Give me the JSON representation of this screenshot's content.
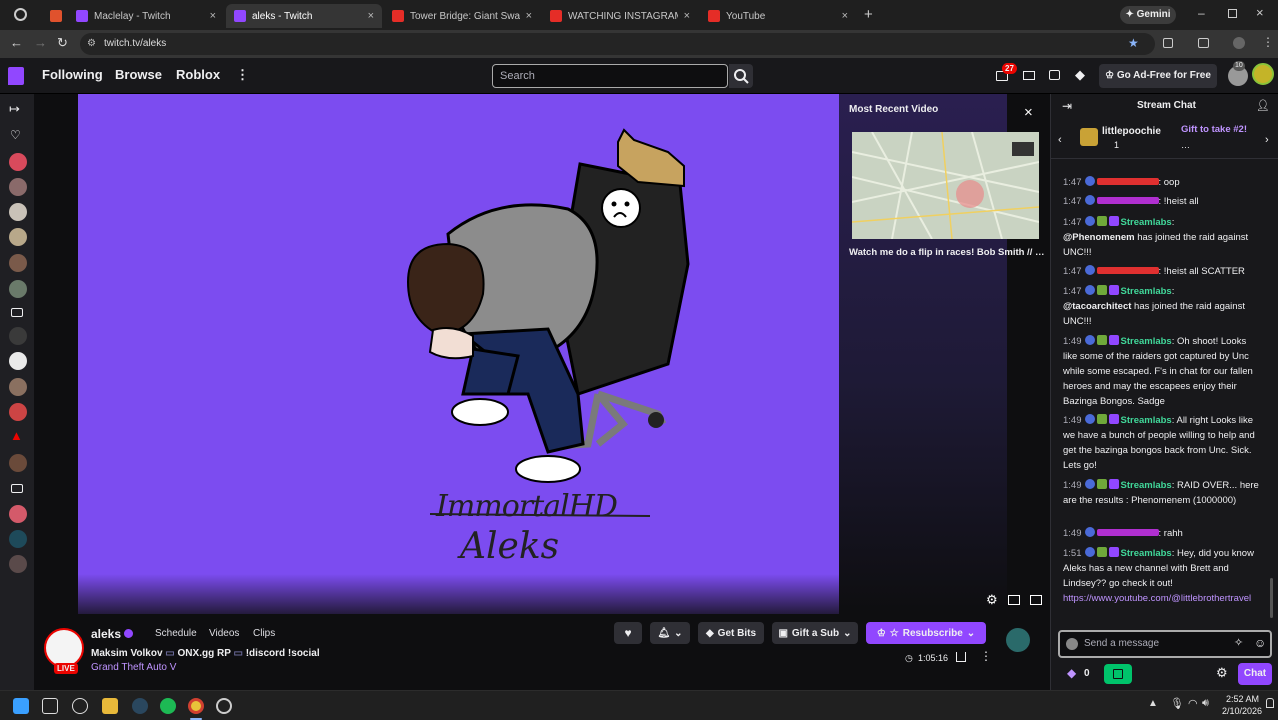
{
  "browser": {
    "tabs": [
      {
        "title": "",
        "active": false
      },
      {
        "title": "",
        "active": false
      },
      {
        "title": "Maclelay - Twitch",
        "active": false
      },
      {
        "title": "aleks - Twitch",
        "active": true
      },
      {
        "title": "Tower Bridge: Giant Swan | To…",
        "active": false
      },
      {
        "title": "WATCHING INSTAGRAM REEL…",
        "active": false
      },
      {
        "title": "YouTube",
        "active": false
      }
    ],
    "gemini_label": "Gemini",
    "url": "twitch.tv/aleks"
  },
  "nav": {
    "following": "Following",
    "browse": "Browse",
    "roblox": "Roblox",
    "search_placeholder": "Search",
    "notif_count": "27",
    "ad_free": "Go Ad-Free for Free",
    "avatar_badge": "10"
  },
  "player": {
    "signature_top": "ImmortalHD",
    "signature_bottom": "Aleks",
    "recent_title": "Most Recent Video",
    "recent_caption": "Watch me do a flip in races! Bob Smith // …"
  },
  "channel": {
    "name": "aleks",
    "live": "LIVE",
    "tabs": [
      "Schedule",
      "Videos",
      "Clips"
    ],
    "title_parts": [
      "Maksim Volkov",
      "ONX.gg RP",
      "!discord !social"
    ],
    "game": "Grand Theft Auto V",
    "uptime": "1:05:16",
    "get_bits": "Get Bits",
    "gift_sub": "Gift a Sub",
    "resubscribe": "Resubscribe"
  },
  "chat": {
    "header": "Stream Chat",
    "pinned_user": "littlepoochie",
    "pinned_count": "1",
    "pinned_gift": "Gift to take #2!",
    "pinned_more": "…",
    "input_placeholder": "Send a message",
    "points": "0",
    "chat_button": "Chat",
    "messages": [
      {
        "ts": "1:47",
        "user": "",
        "user_color": "#e03030",
        "text": ": oop"
      },
      {
        "ts": "1:47",
        "user": "",
        "user_color": "#b02fd0",
        "text": ": !heist all"
      },
      {
        "ts": "1:47",
        "user": "Streamlabs",
        "user_color": "#41d89a",
        "text": ": ",
        "mention": "@Phenomenem",
        "rest": " has joined the raid against UNC!!!"
      },
      {
        "ts": "1:47",
        "user": "",
        "user_color": "#e03030",
        "text": ": !heist all SCATTER"
      },
      {
        "ts": "1:47",
        "user": "Streamlabs",
        "user_color": "#41d89a",
        "text": ": ",
        "mention": "@tacoarchitect",
        "rest": " has joined the raid against UNC!!!"
      },
      {
        "ts": "1:49",
        "user": "Streamlabs",
        "user_color": "#41d89a",
        "text": ": Oh shoot! Looks like some of the raiders got captured by Unc while some escaped. F's in chat for our fallen heroes and may the escapees enjoy their Bazinga Bongos. Sadge"
      },
      {
        "ts": "1:49",
        "user": "Streamlabs",
        "user_color": "#41d89a",
        "text": ": All right Looks like we have a bunch of people willing to help and get the bazinga bongos back from Unc. Sick. Lets go!"
      },
      {
        "ts": "1:49",
        "user": "Streamlabs",
        "user_color": "#41d89a",
        "text": ": RAID OVER... here are the results : Phenomenem (1000000)"
      },
      {
        "ts": "1:49",
        "user": "",
        "user_color": "#b02fd0",
        "text": ": rahh"
      },
      {
        "ts": "1:51",
        "user": "Streamlabs",
        "user_color": "#41d89a",
        "text": ": Hey, did you know Aleks has a new channel with Brett and Lindsey?? go check it out!",
        "link": "https://www.youtube.com/@littlebrothertravel"
      }
    ]
  },
  "taskbar": {
    "time": "2:52 AM",
    "date": "2/10/2026"
  },
  "colors": {
    "twitch_purple": "#9147ff",
    "video_bg": "#7c4cf0",
    "live_red": "#eb0400",
    "streamlabs_green": "#41d89a"
  }
}
